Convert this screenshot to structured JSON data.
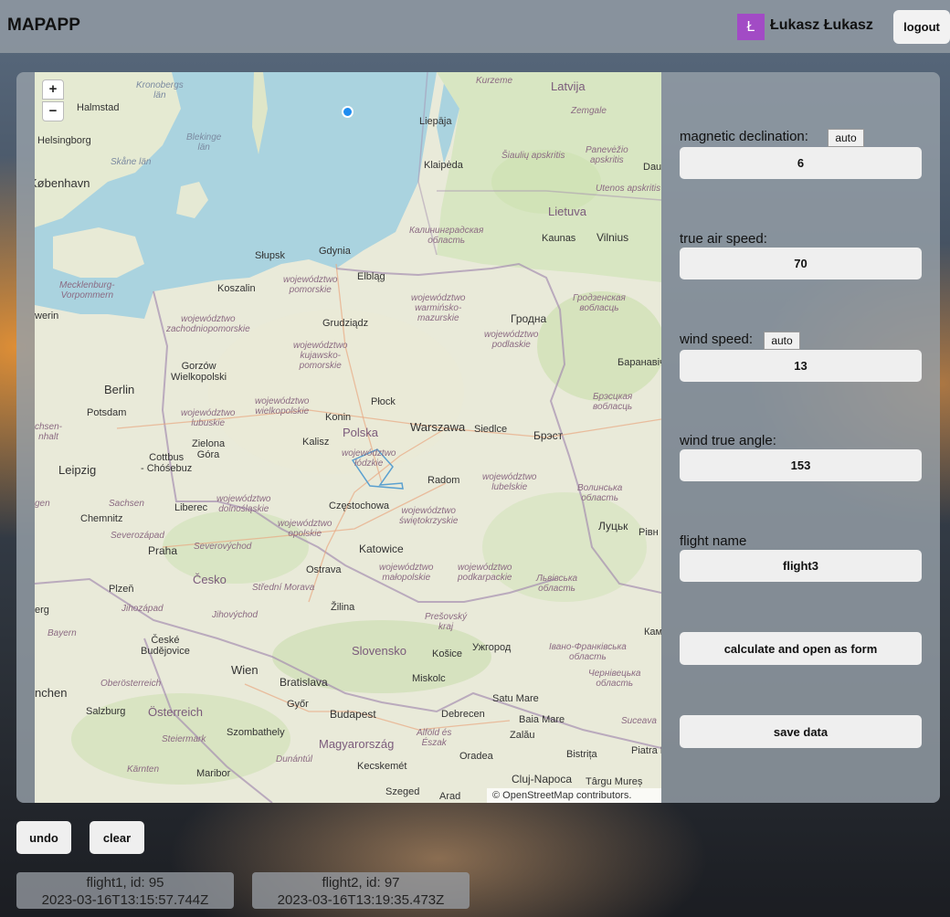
{
  "header": {
    "app_title": "MAPAPP",
    "avatar_letter": "Ł",
    "avatar_color": "#a24bc5",
    "user_name": "Łukasz Łukasz",
    "logout_label": "logout"
  },
  "map": {
    "zoom_in": "+",
    "zoom_out": "−",
    "attribution": "© OpenStreetMap contributors.",
    "labels": {
      "kronobergs": "Kronobergs\nlän",
      "halmstad": "Halmstad",
      "blekinge": "Blekinge\nlän",
      "helsingborg": "Helsingborg",
      "skane": "Skåne län",
      "kobenhavn": "København",
      "kurzeme": "Kurzeme",
      "latvija": "Latvija",
      "zemgale": "Zemgale",
      "liepaja": "Liepāja",
      "panevezio": "Panevėžio\napskritis",
      "klaipeda": "Klaipėda",
      "siauliu": "Šiaulių apskritis",
      "daug": "Daug",
      "utenos": "Utenos apskritis",
      "lietuva": "Lietuva",
      "kaliningrad": "Калининградская\nобласть",
      "kaunas": "Kaunas",
      "vilnius": "Vilnius",
      "slupsk": "Słupsk",
      "gdynia": "Gdynia",
      "elblag": "Elbląg",
      "koszalin": "Koszalin",
      "pomorskie": "województwo\npomorskie",
      "mecklenburg": "Mecklenburg-\nVorpommern",
      "warminsko": "województwo\nwarmińsko-\nmazurskie",
      "grodno_obl": "Гродзенская\nвобласць",
      "werin": "werin",
      "zachodniopomorskie": "województwo\nzachodniopomorskie",
      "grudziadz": "Grudziądz",
      "grodno": "Гродна",
      "podlaskie": "województwo\npodlaskie",
      "gorzow": "Gorzów\nWielkopolski",
      "kujawsko": "województwo\nkujawsko-\npomorskie",
      "baranavichy": "Баранавічы",
      "berlin": "Berlin",
      "potsdam": "Potsdam",
      "wielkopolskie": "województwo\nwielkopolskie",
      "plock": "Płock",
      "brest_obl": "Брэсцкая\nвобласць",
      "lubuskie": "województwo\nlubuskie",
      "konin": "Konin",
      "polska": "Polska",
      "warszawa": "Warszawa",
      "sachsen_anhalt": "chsen-\nnhalt",
      "zielona_gora": "Zielona\nGóra",
      "kalisz": "Kalisz",
      "siedlce": "Siedlce",
      "brest": "Брэст",
      "cottbus": "Cottbus\n- Chóśebuz",
      "lodzkie": "województwo\nłódzkie",
      "leipzig": "Leipzig",
      "radom": "Radom",
      "lubelskie": "województwo\nlubelskie",
      "volyn": "Волинська\nобласть",
      "gen": "gen",
      "sachsen": "Sachsen",
      "liberec": "Liberec",
      "dolnoslaskie": "województwo\ndolnośląskie",
      "czestochowa": "Częstochowa",
      "swietokrzyskie": "województwo\nświętokrzyskie",
      "chemnitz": "Chemnitz",
      "opolskie": "województwo\nopolskie",
      "lutsk": "Луцьк",
      "rivne": "Рівн",
      "severozapad": "Severozápad",
      "severovychod": "Severovýchod",
      "praha": "Praha",
      "katowice": "Katowice",
      "cesko": "Česko",
      "ostrava": "Ostrava",
      "malopolskie": "województwo\nmałopolskie",
      "podkarpackie": "województwo\npodkarpackie",
      "lviv": "Львівська\nобласть",
      "plzen": "Plzeň",
      "stredni_morava": "Střední Morava",
      "jihozapad": "Jihozápad",
      "jihovychod": "Jihovýchod",
      "zilina": "Žilina",
      "presovsky": "Prešovský\nkraj",
      "erg": "erg",
      "kam": "Кам",
      "bayern": "Bayern",
      "ceske_budejovice": "České\nBudějovice",
      "slovensko": "Slovensko",
      "kosice": "Košice",
      "uzhorod": "Ужгород",
      "ivano": "Івано-Франківська\nобласть",
      "wien": "Wien",
      "bratislava": "Bratislava",
      "miskolc": "Miskolc",
      "chernivtsi": "Чернівецька\nобласть",
      "nchen": "nchen",
      "oberosterreich": "Oberösterreich",
      "satu_mare": "Satu Mare",
      "salzburg": "Salzburg",
      "osterreich": "Österreich",
      "gyor": "Győr",
      "budapest": "Budapest",
      "debrecen": "Debrecen",
      "baia_mare": "Baia Mare",
      "suceava": "Suceava",
      "steiermark": "Steiermark",
      "szombathely": "Szombathely",
      "magyarorszag": "Magyarország",
      "alfold": "Alföld és\nÉszak",
      "zalau": "Zalău",
      "bistrita": "Bistrița",
      "piatra": "Piatra Ne",
      "dunantul": "Dunántúl",
      "oradea": "Oradea",
      "karnten": "Kärnten",
      "maribor": "Maribor",
      "kecskemet": "Kecskemét",
      "cluj": "Cluj-Napoca",
      "targu": "Târgu Mureș",
      "szeged": "Szeged",
      "arad": "Arad"
    }
  },
  "form": {
    "magnetic_declination_label": "magnetic declination:",
    "magnetic_declination_auto": "auto",
    "magnetic_declination_value": "6",
    "true_air_speed_label": "true air speed:",
    "true_air_speed_value": "70",
    "wind_speed_label": "wind speed:",
    "wind_speed_auto": "auto",
    "wind_speed_value": "13",
    "wind_true_angle_label": "wind true angle:",
    "wind_true_angle_value": "153",
    "flight_name_label": "flight name",
    "flight_name_value": "flight3",
    "calculate_label": "calculate and open as form",
    "save_label": "save data"
  },
  "controls": {
    "undo_label": "undo",
    "clear_label": "clear"
  },
  "flights": [
    {
      "title": "flight1, id: 95",
      "timestamp": "2023-03-16T13:15:57.744Z"
    },
    {
      "title": "flight2, id: 97",
      "timestamp": "2023-03-16T13:19:35.473Z"
    }
  ]
}
